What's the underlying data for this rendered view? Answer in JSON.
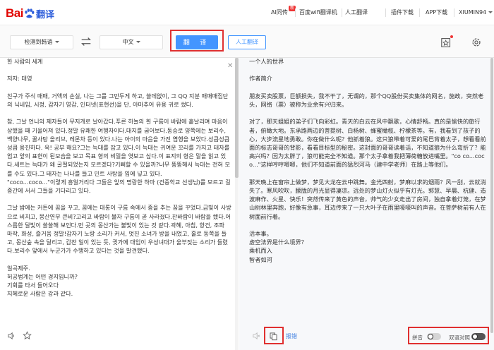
{
  "header": {
    "logo_text": "Bai",
    "logo_suffix": "翻译",
    "nav": {
      "ai_tongchuan": "AI同传",
      "badge": "新",
      "wifi": "百度wifi翻译机",
      "human": "人工翻译",
      "plugin": "插件下载",
      "app": "APP下载",
      "user": "XIUMIN94"
    }
  },
  "langbar": {
    "source_lang": "检测到韩语",
    "target_lang": "中文",
    "translate_label": "翻 译",
    "human_label": "人工翻译"
  },
  "source": {
    "text": "한 사람의 세계\n\n저자: 태영\n\n친구가 주식 매매, 거액의 손실, 나는 그를 그만두게 하고, 쓸데없이, 그 QQ 지분 매매매집단의 닉네임, 시정, 갑자기 영감, 인터넷(표현선)을 단, 아마추어 유용 귀로 썼다.\n\n참, 그날 언니의 제자들이 무지개로 날아갔다.푸른 하늘의 흰 구름이 바람에 흩날리며 마음이 상했을 때 기울어져 있다.정말 유쾌한 여행자이다.대지를 굽어보다.동승로 양쪽에는 보리수, 백양나무, 꿀사탕 올리브, 레몬차 등이 있다.나는 아이의 마음을 가진 엽행을 보았다.성큼성큼성큼 용진하다. 윽! 공부 해요?그는 늑대를 잡고 있다.이 늑대는 귀여운 꼬리를 가지고 태자를 업고 앞의 표현이 된모습을 보고 목표 형의 비밀을 엿보고 싶다.이 표지의 형은 말을 읽고 있다.세트는 늑대가 왜 굴절되었는지 모르겠다?기뻐할 수 있을까?너무 뚱뚱해서 늑대는 전혀 모를 수도 있다.그 태자는 나나를 들고 민트 사탕을 입에 넣고 있다.\n\"coco...coco...\"이렇게 흥얼거리다 그들은 앞의 명랑한 하마 (건중학교 선생님)를 모르고 길 중간에 서서 그들을 기다리고 있다.\n\n그날 밤에는 커튼에 꿈을 꾸고, 꿈에는 대롱이 구름 속에서 중을 추는 꿈을 꾸었다.금빛이 사방으로 비치고, 몽산연무 큰비?고리고 바람이 불자 구름이 곧 사라졌다.찬바람이 바람을 쐤다.어스름한 달빛이 쓸쓸해 보인다.먼 곳의 몽산가는 불빛이 있는 것 같다.곽혜, 아침, 항건, 조파 마작, 화성, 즐거움 정말!갑자기 노랑 소리가 커서, 멋진 소녀가 방을 내었고, 홀로 동쪽을 들고, 몽산숲 속을 달리고, 갑찬 일이 있는 듯, 귓가에 대입이 우성녀대가 울부짖는 소리가 들렸다.보리수 앞에서 누군가가 수행하고 있다는 것을 발견했다.\n\n일곡제주.\n허공법계는 어떤 경지입니까?\n기회를 타서 들어오다\n지혜로운 사람은 강과 같다."
  },
  "target": {
    "text": "一个人的世界\n\n作者简介\n\n朋友买卖股票，巨额损失，我不干了，无谓的，那个QQ股份买卖集体的网名，施政，突然老头，网络（票）被称为业余有兴归来。\n\n对了，那天姐姐的弟子们飞向彩虹。青天的白云在风中飘歌，心情舒畅。真的是愉快的旅行者，俯瞰大地。东承路两边的菩提树、白杨树、蜂蜜橄榄、柠檬茶等。有，我看到了孩子的心，大步流星地勇敢。你在做什么呢？他抓着狼。这只狼带着可爱的尾巴背着太子，想看看前面的标志哥哥的背影，看看目标型的秘密。这封面的哥哥读着话，不知道狼为什么弯折了？能高兴吗？因为太胖了，狼可能完全不知道。那个太子拿着我把薄荷糖放进嘴里。\"co co...coco...\"这样哼哼唧唧，他们不知道前面的猛烈河马（建中学老师）在路上等他们。\n\n那天晚上在窗帘上做梦，梦见大龙在云中跳舞。金光四射，梦麻以求的烟雨？风一刮，云就消失了。寒风吹吹，朦胧的月光显得凄凉。远处的梦山灯火似乎有灯光。郭慧、早晨、杭健、造波麻作、火星、快乐！突然传来了黄色的声音，帅气的少女走出了房间，独自拿着灯笼，在梦山树林里奔跑，好像有急事，耳边传来了一只大叶子在雨里嚎嚎叫的声音。在菩萨树前有人在树面前行着。\n\n活本事。\n虚空法界是什么境界？\n乘机而入\n智者如河"
  },
  "footer": {
    "feedback_label": "报错",
    "toggle_pinyin": "拼音",
    "toggle_bilingual": "双语对照"
  },
  "colors": {
    "accent": "#4395ff",
    "highlight": "#e03030",
    "brand_red": "#e10602"
  }
}
